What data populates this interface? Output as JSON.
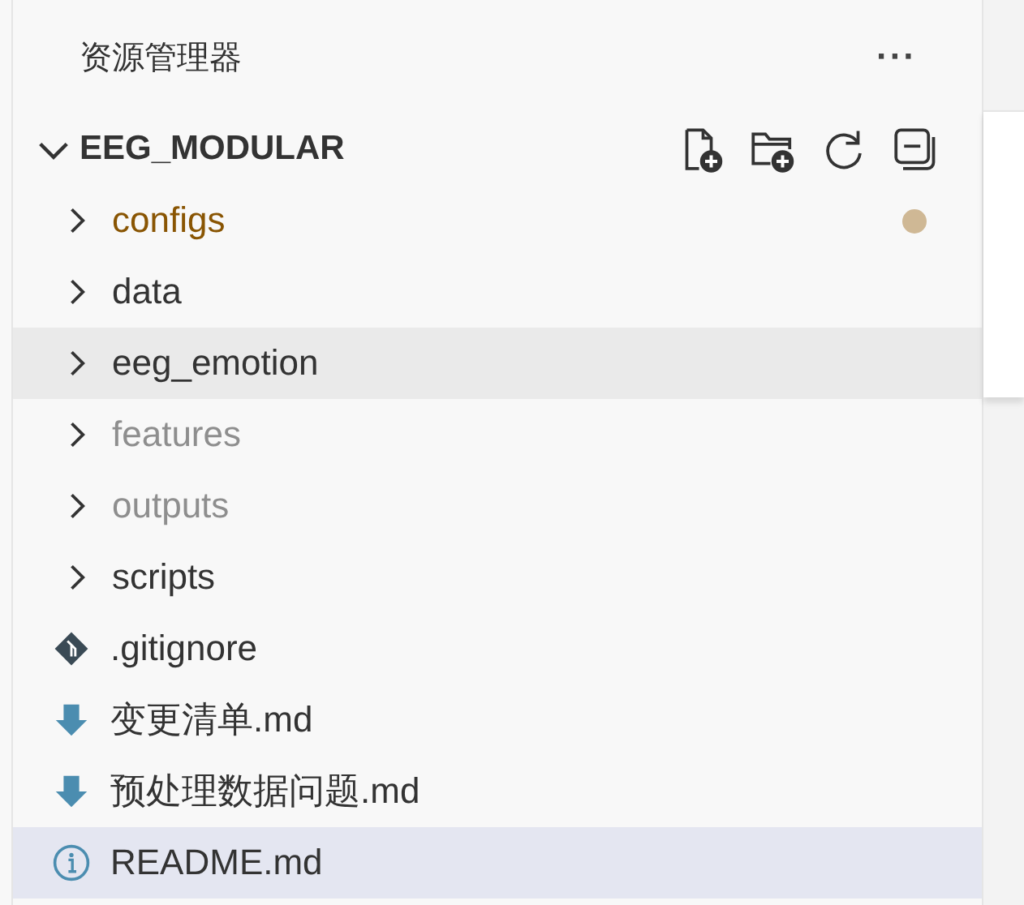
{
  "explorer": {
    "title": "资源管理器",
    "more": "···"
  },
  "project": {
    "name": "EEG_MODULAR",
    "expanded": true
  },
  "items": [
    {
      "kind": "folder",
      "name": "configs",
      "modified": true,
      "ignored": false,
      "hovered": false,
      "selected": false
    },
    {
      "kind": "folder",
      "name": "data",
      "modified": false,
      "ignored": false,
      "hovered": false,
      "selected": false
    },
    {
      "kind": "folder",
      "name": "eeg_emotion",
      "modified": false,
      "ignored": false,
      "hovered": true,
      "selected": false
    },
    {
      "kind": "folder",
      "name": "features",
      "modified": false,
      "ignored": true,
      "hovered": false,
      "selected": false
    },
    {
      "kind": "folder",
      "name": "outputs",
      "modified": false,
      "ignored": true,
      "hovered": false,
      "selected": false
    },
    {
      "kind": "folder",
      "name": "scripts",
      "modified": false,
      "ignored": false,
      "hovered": false,
      "selected": false
    },
    {
      "kind": "git",
      "name": ".gitignore",
      "modified": false,
      "ignored": false,
      "hovered": false,
      "selected": false
    },
    {
      "kind": "markdown",
      "name": "变更清单.md",
      "modified": false,
      "ignored": false,
      "hovered": false,
      "selected": false
    },
    {
      "kind": "markdown",
      "name": "预处理数据问题.md",
      "modified": false,
      "ignored": false,
      "hovered": false,
      "selected": false
    },
    {
      "kind": "info",
      "name": "README.md",
      "modified": false,
      "ignored": false,
      "hovered": false,
      "selected": true
    }
  ]
}
